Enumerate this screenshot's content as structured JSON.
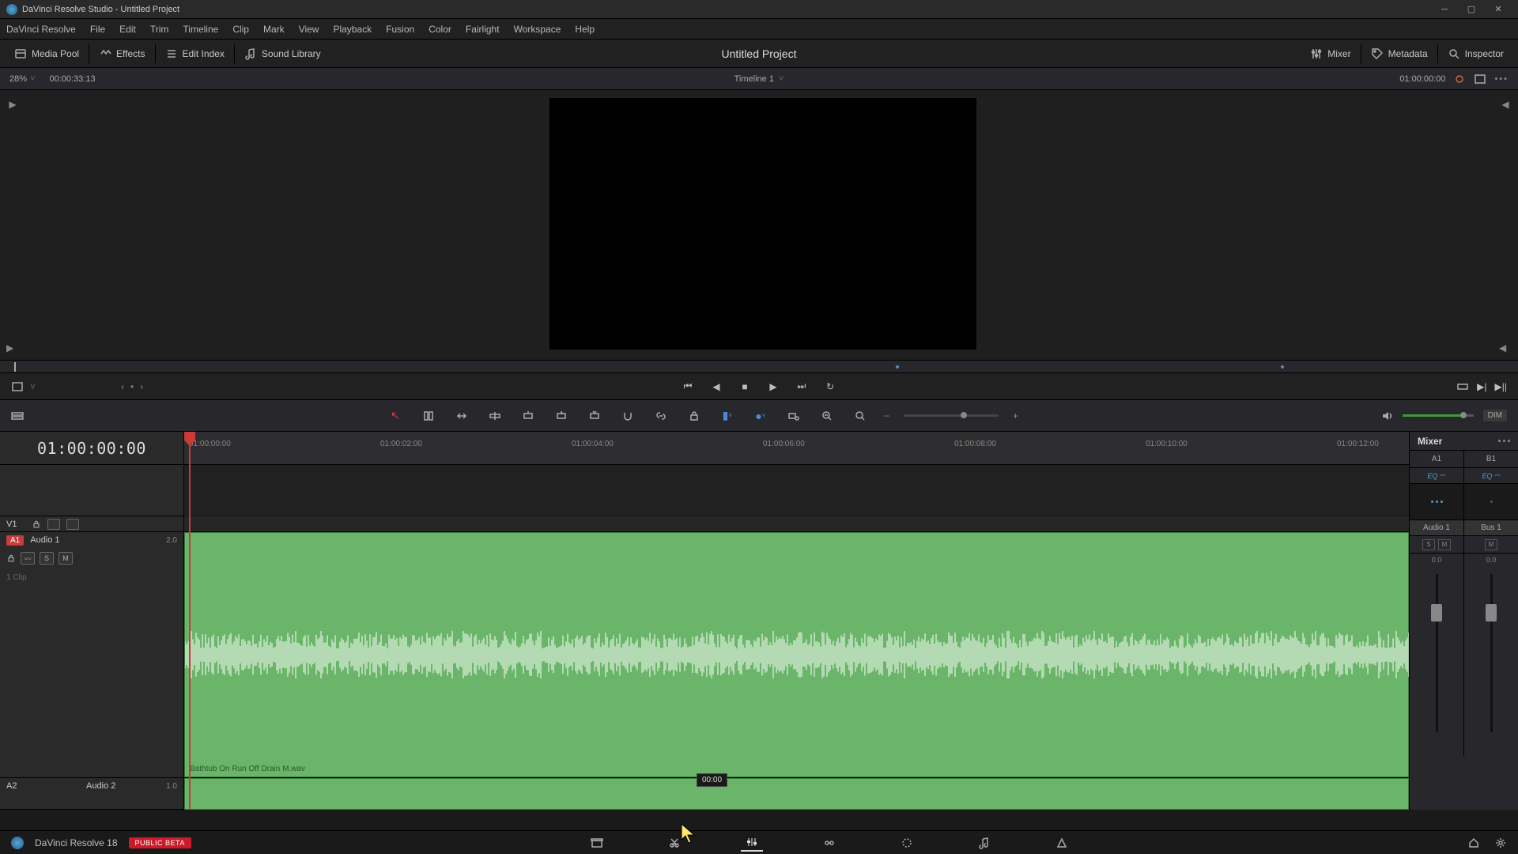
{
  "titlebar": {
    "title": "DaVinci Resolve Studio - Untitled Project"
  },
  "menu": [
    "DaVinci Resolve",
    "File",
    "Edit",
    "Trim",
    "Timeline",
    "Clip",
    "Mark",
    "View",
    "Playback",
    "Fusion",
    "Color",
    "Fairlight",
    "Workspace",
    "Help"
  ],
  "toptool": {
    "media_pool": "Media Pool",
    "effects": "Effects",
    "edit_index": "Edit Index",
    "sound_library": "Sound Library",
    "project_title": "Untitled Project",
    "mixer": "Mixer",
    "metadata": "Metadata",
    "inspector": "Inspector"
  },
  "viewerbar": {
    "zoom": "28%",
    "duration": "00:00:33:13",
    "timeline_name": "Timeline 1",
    "record_tc": "01:00:00:00"
  },
  "timecode": "01:00:00:00",
  "ruler_ticks": [
    "01:00:00:00",
    "01:00:02:00",
    "01:00:04:00",
    "01:00:06:00",
    "01:00:08:00",
    "01:00:10:00",
    "01:00:12:00"
  ],
  "tracks": {
    "v1": {
      "label": "V1"
    },
    "a1": {
      "badge": "A1",
      "label": "Audio 1",
      "chan": "2.0",
      "clips": "1 Clip",
      "clip_name": "Bathtub On Run Off Drain M.wav"
    },
    "a2": {
      "label": "A2",
      "name": "Audio 2",
      "chan": "1.0"
    }
  },
  "mixer": {
    "title": "Mixer",
    "ch": [
      {
        "id": "A1",
        "eq": "EQ",
        "name": "Audio 1",
        "db": "0.0"
      },
      {
        "id": "B1",
        "eq": "EQ",
        "name": "Bus 1",
        "db": "0.0"
      }
    ],
    "sm": [
      "S",
      "M"
    ]
  },
  "toolstrip": {
    "dim": "DIM"
  },
  "tooltip": "00:00",
  "footer": {
    "app": "DaVinci Resolve 18",
    "beta": "PUBLIC BETA"
  }
}
